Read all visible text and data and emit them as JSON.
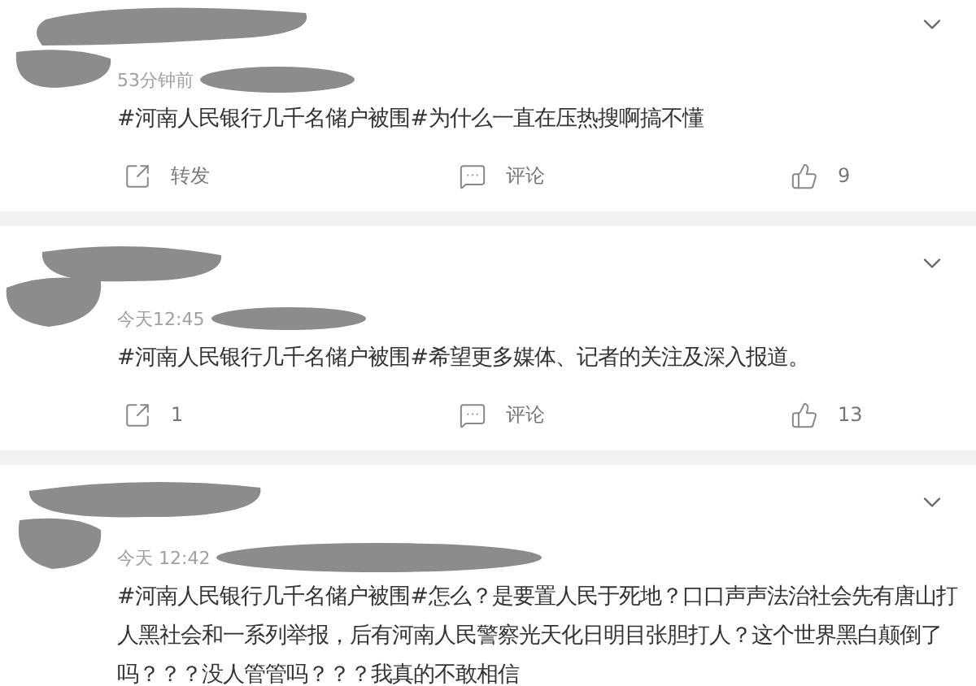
{
  "posts": [
    {
      "time": "53分钟前",
      "text": "#河南人民银行几千名储户被围#为什么一直在压热搜啊搞不懂",
      "actions": [
        {
          "kind": "repost",
          "label": "转发"
        },
        {
          "kind": "comment",
          "label": "评论"
        },
        {
          "kind": "like",
          "label": "9"
        }
      ]
    },
    {
      "time": "今天12:45",
      "text": "#河南人民银行几千名储户被围#希望更多媒体、记者的关注及深入报道。",
      "actions": [
        {
          "kind": "repost",
          "label": "1"
        },
        {
          "kind": "comment",
          "label": "评论"
        },
        {
          "kind": "like",
          "label": "13"
        }
      ]
    },
    {
      "time": "今天 12:42",
      "text": "#河南人民银行几千名储户被围#怎么？是要置人民于死地？口口声声法治社会先有唐山打人黑社会和一系列举报，后有河南人民警察光天化日明目张胆打人？这个世界黑白颠倒了吗？？？没人管管吗？？？我真的不敢相信"
    }
  ]
}
